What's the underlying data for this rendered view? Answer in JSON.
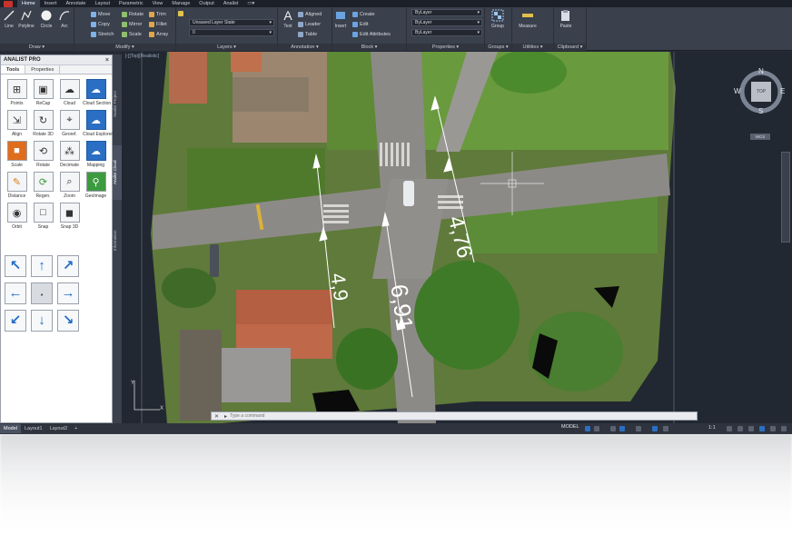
{
  "menu": [
    "Home",
    "Insert",
    "Annotate",
    "Layout",
    "Parametric",
    "View",
    "Manage",
    "Output",
    "Analist"
  ],
  "ribbon": {
    "draw": {
      "title": "Draw",
      "line": "Line",
      "polyline": "Polyline",
      "circle": "Circle",
      "arc": "Arc"
    },
    "modify": {
      "title": "Modify",
      "move": "Move",
      "rotate": "Rotate",
      "trim": "Trim",
      "copy": "Copy",
      "mirror": "Mirror",
      "fillet": "Fillet",
      "stretch": "Stretch",
      "scale": "Scale",
      "array": "Array"
    },
    "layers": {
      "title": "Layers",
      "state": "Unsaved Layer State",
      "current": "0"
    },
    "annotation": {
      "title": "Annotation",
      "text": "Text",
      "aligned": "Aligned",
      "leader": "Leader",
      "table": "Table"
    },
    "block": {
      "title": "Block",
      "insert": "Insert",
      "create": "Create",
      "edit": "Edit",
      "edit_attributes": "Edit Attributes"
    },
    "properties": {
      "title": "Properties",
      "color": "ByLayer",
      "linetype": "ByLayer",
      "lineweight": "ByLayer"
    },
    "groups": {
      "title": "Groups",
      "group": "Group"
    },
    "utilities": {
      "title": "Utilities",
      "measure": "Measure"
    },
    "clipboard": {
      "title": "Clipboard",
      "paste": "Paste"
    }
  },
  "palette": {
    "title": "ANALIST PRO",
    "tabs": [
      "Tools",
      "Properties"
    ],
    "tools": [
      "Points",
      "ReCap",
      "Cloud",
      "Cloud Section",
      "Align",
      "Rotate 3D",
      "Georef.",
      "Cloud Explorer",
      "Scale",
      "Rotate",
      "Decimate",
      "Mapping",
      "Distance",
      "Regen.",
      "Zoom",
      "GeoImage",
      "Orbit",
      "Snap",
      "Snap 3D"
    ]
  },
  "sidetabs": [
    "Analist Project",
    "Analist Cloud",
    "Information"
  ],
  "viewport": {
    "label": "[-][Top][Realistic]",
    "measurements": [
      "4,76",
      "4,9",
      "6,91"
    ],
    "command_placeholder": "Type a command",
    "viewcube": {
      "n": "N",
      "s": "S",
      "e": "E",
      "w": "W",
      "face": "TOP",
      "wcs": "WCS"
    },
    "ucs": {
      "x": "X",
      "y": "Y"
    }
  },
  "status": {
    "tabs": [
      "Model",
      "Layout1",
      "Layout2"
    ],
    "add": "+",
    "model": "MODEL",
    "scale": "1:1"
  },
  "colors": {
    "accent": "#1f6cc4",
    "app_bg": "#262b35",
    "ribbon": "#3a404c"
  }
}
